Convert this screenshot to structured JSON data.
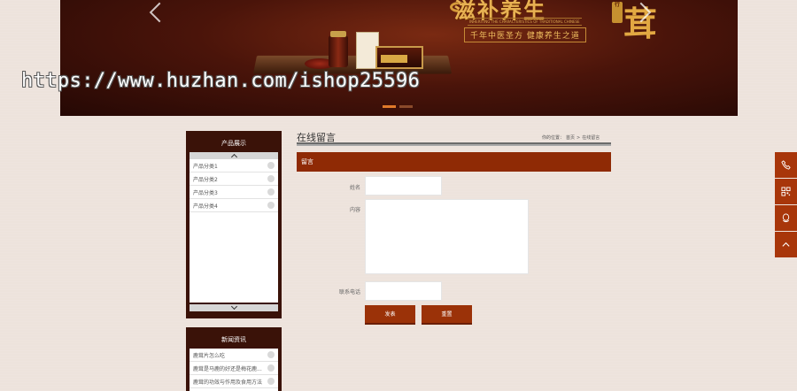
{
  "banner": {
    "title": "滋补养生",
    "seal": "行",
    "big_char": "茸",
    "tagline_en": "INHERITING THE CHARACTERISTICS OF TRADITIONAL CHINESE",
    "slogan": "千年中医圣方  健康养生之道",
    "box_label": "滋补养生"
  },
  "watermark": "https://www.huzhan.com/ishop25596",
  "sidebar": {
    "products": {
      "title": "产品展示",
      "items": [
        {
          "label": "产品分类1"
        },
        {
          "label": "产品分类2"
        },
        {
          "label": "产品分类3"
        },
        {
          "label": "产品分类4"
        }
      ]
    },
    "news": {
      "title": "新闻资讯",
      "items": [
        {
          "label": "鹿茸片怎么吃"
        },
        {
          "label": "鹿茸是马鹿的好还是梅花鹿..."
        },
        {
          "label": "鹿茸的功效与作用及食用方法"
        }
      ]
    }
  },
  "main": {
    "title": "在线留言",
    "breadcrumb": {
      "prefix": "你的位置：",
      "home": "首页",
      "sep": ">",
      "current": "在线留言"
    },
    "section": "留言",
    "form": {
      "name_label": "姓名",
      "content_label": "内容",
      "phone_label": "联系电话",
      "name_value": "",
      "content_value": "",
      "phone_value": "",
      "submit": "发表",
      "reset": "重置"
    }
  },
  "float_bar": {
    "icons": [
      "phone-icon",
      "qrcode-icon",
      "qq-icon",
      "back-to-top-icon"
    ]
  },
  "colors": {
    "accent": "#8f2a05",
    "button": "#9b3208",
    "sidebar": "#3a1208",
    "background": "#ede3dc"
  }
}
